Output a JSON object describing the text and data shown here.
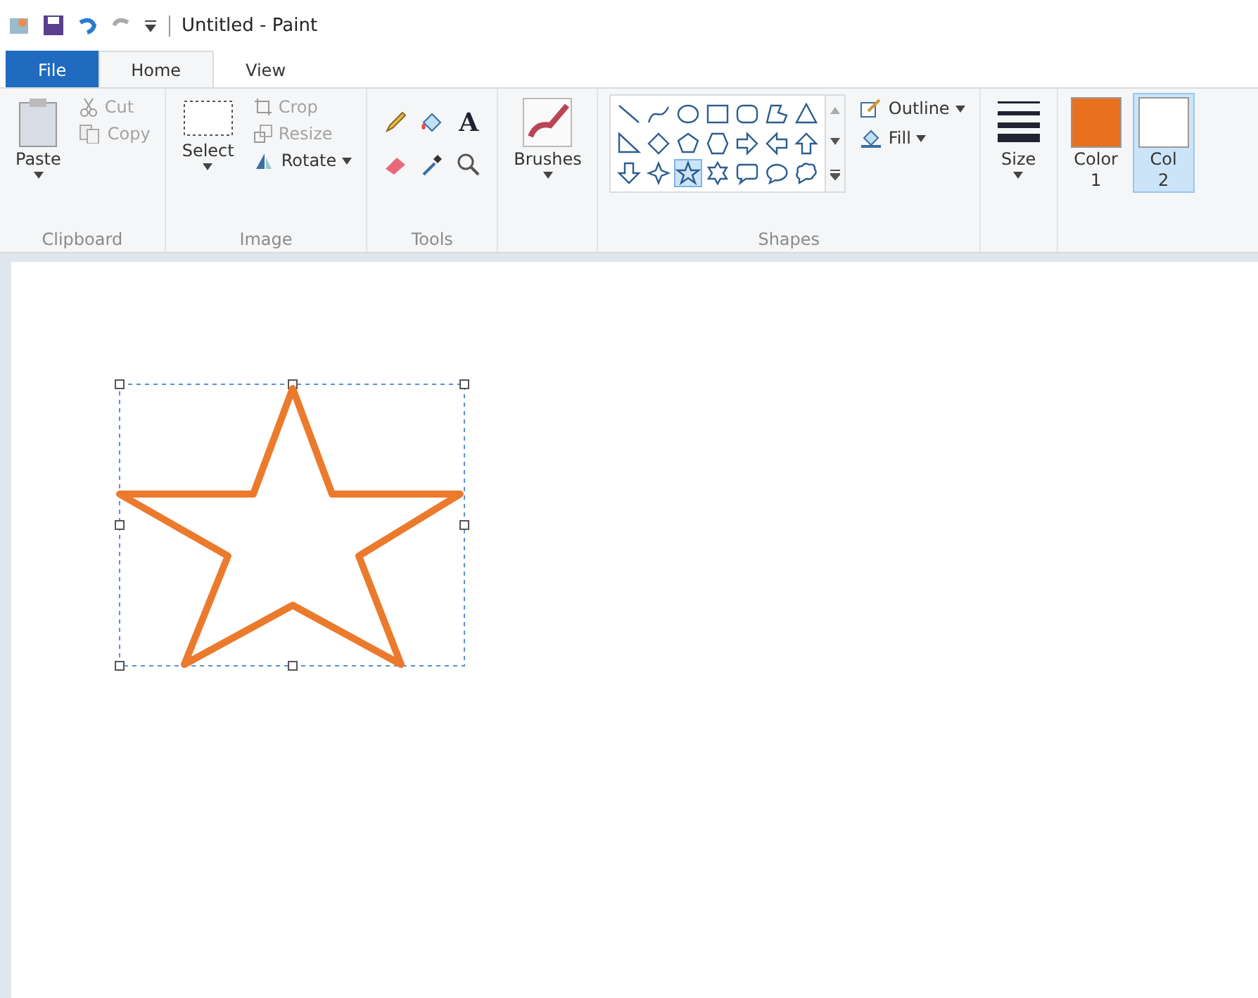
{
  "window": {
    "title": "Untitled - Paint"
  },
  "tabs": [
    {
      "label": "File",
      "kind": "file",
      "selected": false
    },
    {
      "label": "Home",
      "kind": "tab",
      "selected": true
    },
    {
      "label": "View",
      "kind": "tab",
      "selected": false
    }
  ],
  "clipboard": {
    "group": "Clipboard",
    "paste": "Paste",
    "items": [
      {
        "label": "Cut",
        "kind": "cut",
        "disabled": true
      },
      {
        "label": "Copy",
        "kind": "copy",
        "disabled": true
      }
    ]
  },
  "image": {
    "group": "Image",
    "select": "Select",
    "items": [
      {
        "label": "Crop",
        "kind": "crop",
        "disabled": true
      },
      {
        "label": "Resize",
        "kind": "resize",
        "disabled": true
      },
      {
        "label": "Rotate",
        "kind": "rotate",
        "disabled": false
      }
    ]
  },
  "tools": {
    "group": "Tools",
    "items": [
      {
        "kind": "pencil"
      },
      {
        "kind": "fill"
      },
      {
        "kind": "text",
        "label": "A"
      },
      {
        "kind": "eraser"
      },
      {
        "kind": "picker"
      },
      {
        "kind": "magnifier"
      }
    ]
  },
  "brushes": {
    "label": "Brushes"
  },
  "shapes": {
    "group": "Shapes",
    "outline": "Outline",
    "fill": "Fill",
    "items": [
      {
        "kind": "line",
        "selected": false
      },
      {
        "kind": "curve",
        "selected": false
      },
      {
        "kind": "oval",
        "selected": false
      },
      {
        "kind": "rectangle",
        "selected": false
      },
      {
        "kind": "rounded-rectangle",
        "selected": false
      },
      {
        "kind": "polygon",
        "selected": false
      },
      {
        "kind": "triangle",
        "selected": false
      },
      {
        "kind": "right-triangle",
        "selected": false
      },
      {
        "kind": "diamond",
        "selected": false
      },
      {
        "kind": "pentagon",
        "selected": false
      },
      {
        "kind": "hexagon",
        "selected": false
      },
      {
        "kind": "right-arrow",
        "selected": false
      },
      {
        "kind": "left-arrow",
        "selected": false
      },
      {
        "kind": "up-arrow",
        "selected": false
      },
      {
        "kind": "down-arrow",
        "selected": false
      },
      {
        "kind": "four-point-star",
        "selected": false
      },
      {
        "kind": "five-point-star",
        "selected": true
      },
      {
        "kind": "six-point-star",
        "selected": false
      },
      {
        "kind": "rounded-callout",
        "selected": false
      },
      {
        "kind": "oval-callout",
        "selected": false
      },
      {
        "kind": "cloud-callout",
        "selected": false
      }
    ]
  },
  "size": {
    "label": "Size"
  },
  "colors": [
    {
      "label": "Color",
      "number": "1",
      "color": "#e8711e",
      "selected": false
    },
    {
      "label": "Col",
      "number": "2",
      "color": "#ffffff",
      "selected": true
    }
  ],
  "canvas": {
    "color": "#ec7a2c",
    "selected": true
  }
}
